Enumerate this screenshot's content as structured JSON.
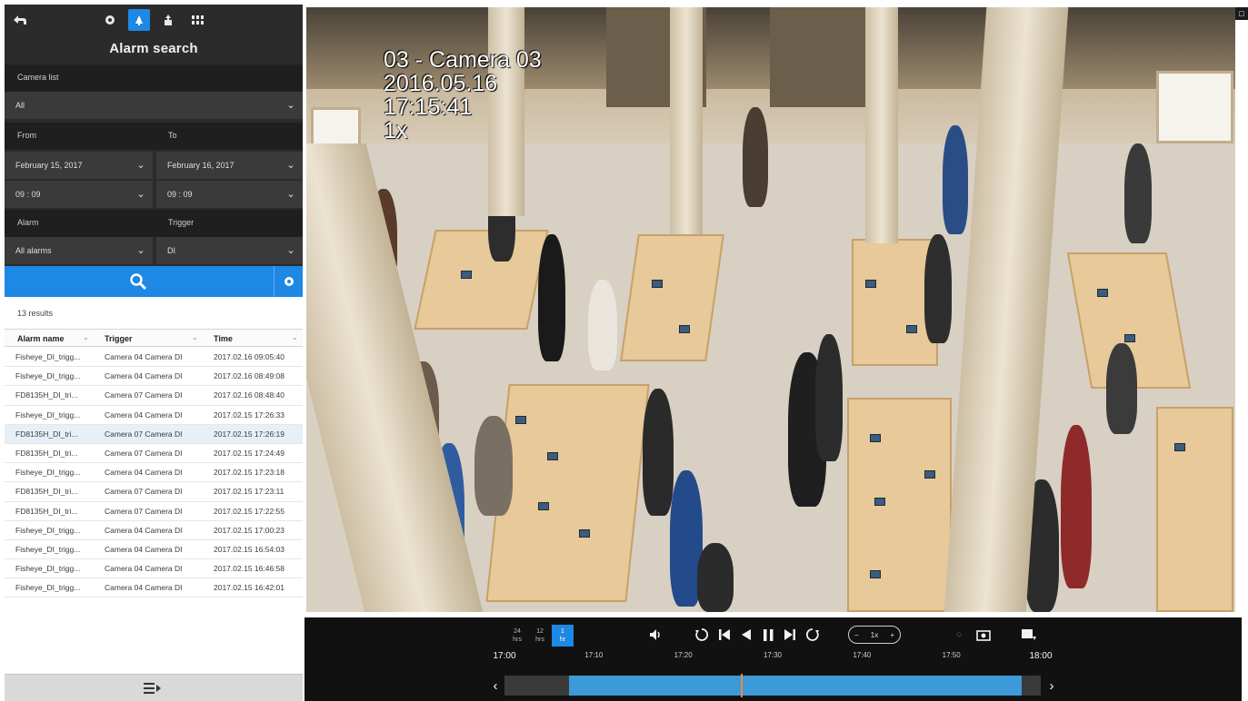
{
  "panel": {
    "title": "Alarm search",
    "icons": {
      "back": "back-icon",
      "live": "camera-icon",
      "alarm": "alarm-bell-icon",
      "export": "export-icon",
      "layout": "grid-icon"
    }
  },
  "filters": {
    "camera_list_label": "Camera list",
    "camera_list_value": "All",
    "from_label": "From",
    "to_label": "To",
    "from_date": "February 15, 2017",
    "to_date": "February 16, 2017",
    "from_time": "09 : 09",
    "to_time": "09 : 09",
    "alarm_label": "Alarm",
    "trigger_label": "Trigger",
    "alarm_value": "All alarms",
    "trigger_value": "DI"
  },
  "results": {
    "count": "13 results",
    "columns": [
      "Alarm name",
      "Trigger",
      "Time"
    ],
    "rows": [
      [
        "Fisheye_DI_trigg...",
        "Camera 04 Camera DI",
        "2017.02.16 09:05:40"
      ],
      [
        "Fisheye_DI_trigg...",
        "Camera 04 Camera DI",
        "2017.02.16 08:49:08"
      ],
      [
        "FD8135H_DI_tri...",
        "Camera 07 Camera DI",
        "2017.02.16 08:48:40"
      ],
      [
        "Fisheye_DI_trigg...",
        "Camera 04 Camera DI",
        "2017.02.15 17:26:33"
      ],
      [
        "FD8135H_DI_tri...",
        "Camera 07 Camera DI",
        "2017.02.15 17:26:19"
      ],
      [
        "FD8135H_DI_tri...",
        "Camera 07 Camera DI",
        "2017.02.15 17:24:49"
      ],
      [
        "Fisheye_DI_trigg...",
        "Camera 04 Camera DI",
        "2017.02.15 17:23:18"
      ],
      [
        "FD8135H_DI_tri...",
        "Camera 07 Camera DI",
        "2017.02.15 17:23:11"
      ],
      [
        "FD8135H_DI_tri...",
        "Camera 07 Camera DI",
        "2017.02.15 17:22:55"
      ],
      [
        "Fisheye_DI_trigg...",
        "Camera 04 Camera DI",
        "2017.02.15 17:00:23"
      ],
      [
        "Fisheye_DI_trigg...",
        "Camera 04 Camera DI",
        "2017.02.15 16:54:03"
      ],
      [
        "Fisheye_DI_trigg...",
        "Camera 04 Camera DI",
        "2017.02.15 16:46:58"
      ],
      [
        "Fisheye_DI_trigg...",
        "Camera 04 Camera DI",
        "2017.02.15 16:42:01"
      ]
    ],
    "selected_row": 4
  },
  "video": {
    "osd_camera": "03 - Camera 03",
    "osd_date": "2016.05.16",
    "osd_time": "17:15:41",
    "osd_speed": "1x"
  },
  "playback": {
    "zoom_options": [
      {
        "top": "24",
        "bottom": "hrs"
      },
      {
        "top": "12",
        "bottom": "hrs"
      },
      {
        "top": "1",
        "bottom": "hr"
      }
    ],
    "speed_value": "1x",
    "ticks": [
      {
        "label": "17:00",
        "big": true
      },
      {
        "label": "17:10",
        "big": false
      },
      {
        "label": "17:20",
        "big": false
      },
      {
        "label": "17:30",
        "big": false
      },
      {
        "label": "17:40",
        "big": false
      },
      {
        "label": "17:50",
        "big": false
      },
      {
        "label": "18:00",
        "big": true
      }
    ],
    "range_start_fraction": 0.12,
    "range_end_fraction": 0.965,
    "playhead_fraction": 0.44
  },
  "colors": {
    "accent": "#1e88e5",
    "panel_dark": "#2b2b2b",
    "playhead": "#ff8a3c"
  }
}
